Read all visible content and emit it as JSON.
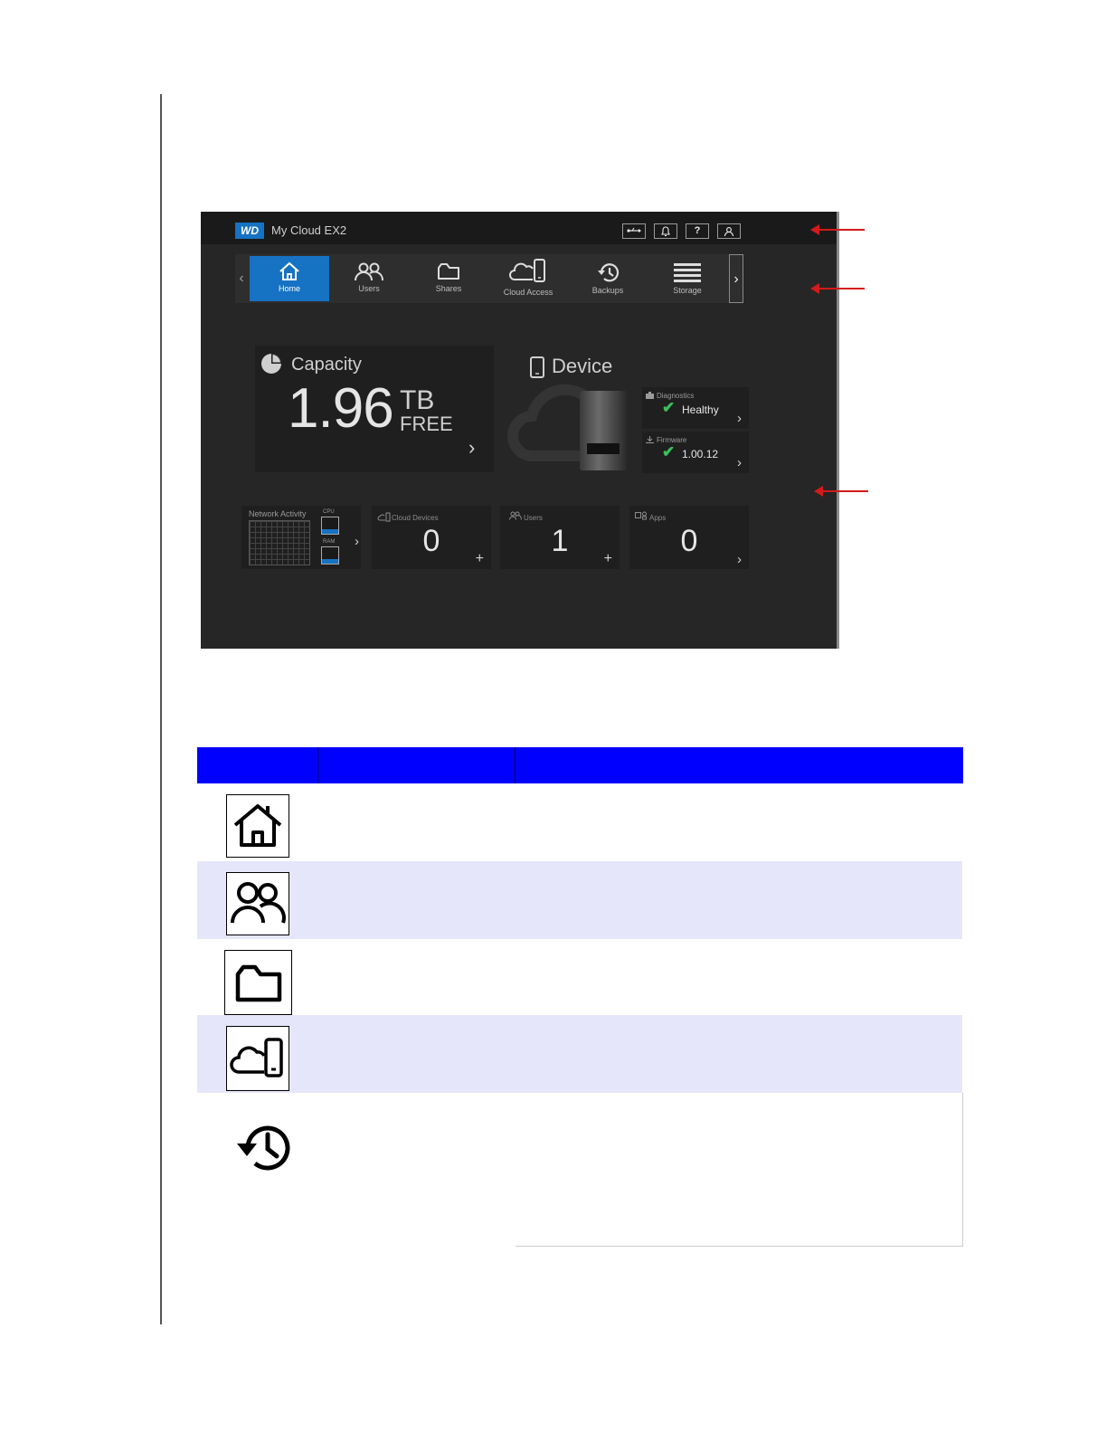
{
  "app": {
    "logo_text": "WD",
    "title": "My Cloud EX2"
  },
  "toolbar": {
    "help_label": "?",
    "icons": [
      "usb-icon",
      "bell-icon",
      "help-icon",
      "user-icon"
    ]
  },
  "nav": {
    "items": [
      {
        "label": "Home",
        "icon": "home-icon",
        "active": true
      },
      {
        "label": "Users",
        "icon": "users-icon",
        "active": false
      },
      {
        "label": "Shares",
        "icon": "folder-icon",
        "active": false
      },
      {
        "label": "Cloud Access",
        "icon": "cloud-device-icon",
        "active": false
      },
      {
        "label": "Backups",
        "icon": "history-icon",
        "active": false
      },
      {
        "label": "Storage",
        "icon": "storage-icon",
        "active": false
      }
    ],
    "prev_label": "‹",
    "next_label": "›"
  },
  "capacity": {
    "title": "Capacity",
    "value": "1.96",
    "unit": "TB",
    "free_label": "FREE"
  },
  "device": {
    "title": "Device",
    "diagnostics": {
      "title": "Diagnostics",
      "value": "Healthy"
    },
    "firmware": {
      "title": "Firmware",
      "value": "1.00.12"
    }
  },
  "tiles": {
    "network": {
      "title": "Network Activity",
      "cpu_label": "CPU",
      "ram_label": "RAM",
      "cpu_level": 0.3,
      "ram_level": 0.3
    },
    "cloud_devices": {
      "title": "Cloud Devices",
      "value": "0"
    },
    "users": {
      "title": "Users",
      "value": "1"
    },
    "apps": {
      "title": "Apps",
      "value": "0"
    }
  },
  "colors": {
    "accent": "#1672c3",
    "ok": "#3bbf5b",
    "annotation_arrow": "#d41a1a",
    "table_header": "#0000ff",
    "table_alt_row": "#e6e6fa"
  },
  "table": {
    "rows": [
      {
        "icon": "home-icon",
        "shaded": false
      },
      {
        "icon": "users-icon",
        "shaded": true
      },
      {
        "icon": "folder-icon",
        "shaded": false
      },
      {
        "icon": "cloud-device-icon",
        "shaded": true
      },
      {
        "icon": "history-icon",
        "shaded": false
      }
    ]
  }
}
